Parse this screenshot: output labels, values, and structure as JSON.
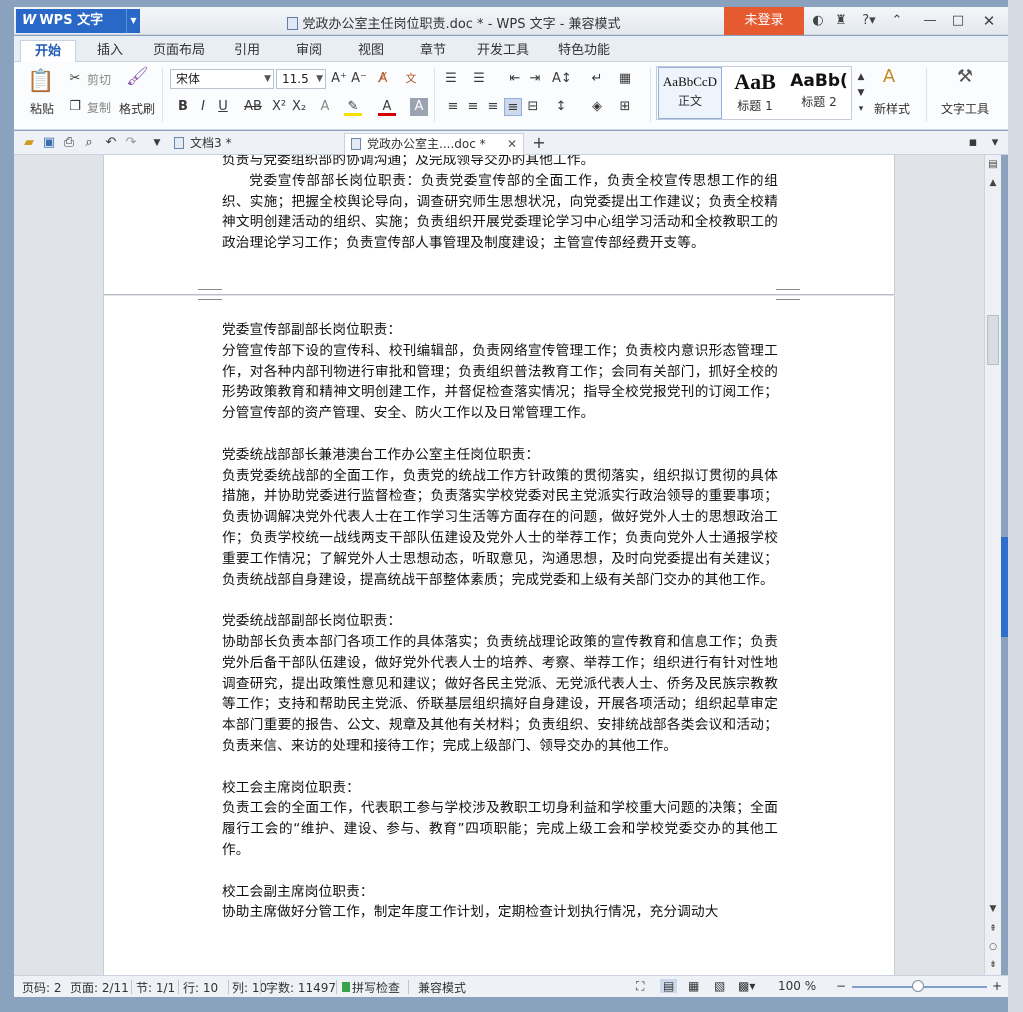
{
  "window": {
    "app_name": "WPS 文字",
    "title": "党政办公室主任岗位职责.doc * - WPS 文字 - 兼容模式",
    "login_button": "未登录"
  },
  "tabs": [
    "开始",
    "插入",
    "页面布局",
    "引用",
    "审阅",
    "视图",
    "章节",
    "开发工具",
    "特色功能"
  ],
  "active_tab": "开始",
  "ribbon": {
    "paste": "粘贴",
    "cut": "剪切",
    "copy": "复制",
    "format_painter": "格式刷",
    "font_name": "宋体",
    "font_size": "11.5",
    "styles": [
      {
        "preview": "AaBbCcD",
        "label": "正文"
      },
      {
        "preview": "AaB",
        "label": "标题 1"
      },
      {
        "preview": "AaBb(",
        "label": "标题 2"
      }
    ],
    "new_style": "新样式",
    "text_tools": "文字工具"
  },
  "doc_tabs": [
    {
      "label": "文档3 *",
      "active": false
    },
    {
      "label": "党政办公室主....doc *",
      "active": true
    }
  ],
  "page1": {
    "line_top": "负责与党委组织部的协调沟通；及完成领导交办的其他工作。",
    "para": "党委宣传部部长岗位职责：负责党委宣传部的全面工作，负责全校宣传思想工作的组织、实施；把握全校舆论导向，调查研究师生思想状况，向党委提出工作建议；负责全校精神文明创建活动的组织、实施；负责组织开展党委理论学习中心组学习活动和全校教职工的政治理论学习工作；负责宣传部人事管理及制度建设；主管宣传部经费开支等。"
  },
  "sections": [
    {
      "heading": "党委宣传部副部长岗位职责：",
      "body": "分管宣传部下设的宣传科、校刊编辑部，负责网络宣传管理工作；负责校内意识形态管理工作，对各种内部刊物进行审批和管理；负责组织普法教育工作；会同有关部门，抓好全校的形势政策教育和精神文明创建工作，并督促检查落实情况；指导全校党报党刊的订阅工作；分管宣传部的资产管理、安全、防火工作以及日常管理工作。"
    },
    {
      "heading": "党委统战部部长兼港澳台工作办公室主任岗位职责：",
      "body": "负责党委统战部的全面工作，负责党的统战工作方针政策的贯彻落实，组织拟订贯彻的具体措施，并协助党委进行监督检查；负责落实学校党委对民主党派实行政治领导的重要事项；负责协调解决党外代表人士在工作学习生活等方面存在的问题，做好党外人士的思想政治工作；负责学校统一战线两支干部队伍建设及党外人士的举荐工作；负责向党外人士通报学校重要工作情况；了解党外人士思想动态，听取意见，沟通思想，及时向党委提出有关建议；负责统战部自身建设，提高统战干部整体素质；完成党委和上级有关部门交办的其他工作。"
    },
    {
      "heading": "党委统战部副部长岗位职责：",
      "body": "协助部长负责本部门各项工作的具体落实；负责统战理论政策的宣传教育和信息工作；负责党外后备干部队伍建设，做好党外代表人士的培养、考察、举荐工作；组织进行有针对性地调查研究，提出政策性意见和建议；做好各民主党派、无党派代表人士、侨务及民族宗教教等工作；支持和帮助民主党派、侨联基层组织搞好自身建设，开展各项活动；组织起草审定本部门重要的报告、公文、规章及其他有关材料；负责组织、安排统战部各类会议和活动；负责来信、来访的处理和接待工作；完成上级部门、领导交办的其他工作。"
    },
    {
      "heading": "校工会主席岗位职责：",
      "body": "负责工会的全面工作，代表职工参与学校涉及教职工切身利益和学校重大问题的决策；全面履行工会的“维护、建设、参与、教育”四项职能；完成上级工会和学校党委交办的其他工作。"
    },
    {
      "heading": "校工会副主席岗位职责：",
      "body": "协助主席做好分管工作，制定年度工作计划，定期检查计划执行情况，充分调动大"
    }
  ],
  "status": {
    "page_num": "页码: 2",
    "pages": "页面: 2/11",
    "section": "节: 1/1",
    "row": "行: 10",
    "col": "列: 10",
    "words": "字数: 11497",
    "spell": "拼写检查",
    "compat": "兼容模式",
    "zoom": "100 %"
  }
}
